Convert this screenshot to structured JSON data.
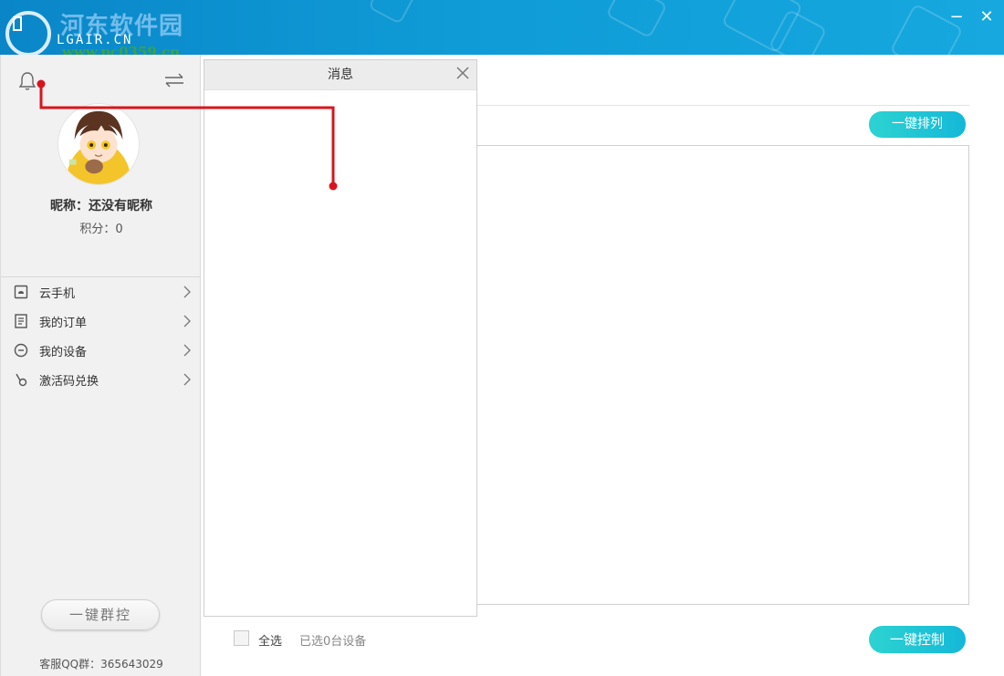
{
  "titlebar": {
    "logo_text": "LGAIR.CN",
    "watermark_cn": "河东软件园",
    "watermark_url": "www.pc0359.cn",
    "minimize_label": "−",
    "close_label": "✕"
  },
  "profile": {
    "nickname": "昵称：还没有昵称",
    "score": "积分：0"
  },
  "sidebar": {
    "items": [
      {
        "label": "云手机",
        "icon": "cloud-phone-icon"
      },
      {
        "label": "我的订单",
        "icon": "order-icon"
      },
      {
        "label": "我的设备",
        "icon": "device-icon"
      },
      {
        "label": "激活码兑换",
        "icon": "redeem-icon"
      }
    ],
    "group_control_label": "一键群控",
    "qq_group": "客服QQ群：365643029"
  },
  "main": {
    "arrange_label": "一键排列",
    "select_all_label": "全选",
    "selected_count": "已选0台设备",
    "control_label": "一键控制"
  },
  "message_panel": {
    "title": "消息"
  },
  "colors": {
    "titlebar": "#0f9bd6",
    "accent_button": "#1fc4d6",
    "annotation": "#d9141c"
  }
}
